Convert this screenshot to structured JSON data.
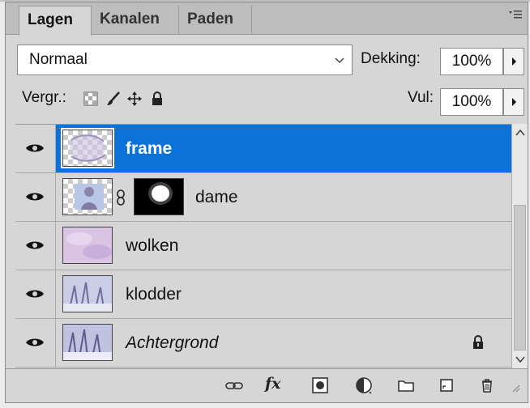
{
  "tabs": [
    {
      "label": "Lagen",
      "active": true
    },
    {
      "label": "Kanalen",
      "active": false
    },
    {
      "label": "Paden",
      "active": false
    }
  ],
  "blend_mode": "Normaal",
  "opacity": {
    "label": "Dekking:",
    "value": "100%"
  },
  "lock": {
    "label": "Vergr.:",
    "icons": [
      "lock-transparent-pixels-icon",
      "lock-image-pixels-icon",
      "lock-position-icon",
      "lock-all-icon"
    ]
  },
  "fill": {
    "label": "Vul:",
    "value": "100%"
  },
  "layers": [
    {
      "name": "frame",
      "selected": true,
      "visible": true,
      "has_mask": false,
      "italic": false,
      "locked": false
    },
    {
      "name": "dame",
      "selected": false,
      "visible": true,
      "has_mask": true,
      "italic": false,
      "locked": false
    },
    {
      "name": "wolken",
      "selected": false,
      "visible": true,
      "has_mask": false,
      "italic": false,
      "locked": false
    },
    {
      "name": "klodder",
      "selected": false,
      "visible": true,
      "has_mask": false,
      "italic": false,
      "locked": false
    },
    {
      "name": "Achtergrond",
      "selected": false,
      "visible": true,
      "has_mask": false,
      "italic": true,
      "locked": true
    }
  ],
  "toolbar": {
    "fx_label": "fx",
    "icons": [
      "link-layers-icon",
      "layer-style-icon",
      "layer-mask-icon",
      "adjustment-layer-icon",
      "group-folder-icon",
      "new-layer-icon",
      "delete-layer-icon"
    ]
  },
  "colors": {
    "selection": "#0a72d8",
    "panel": "#d6d6d6"
  }
}
